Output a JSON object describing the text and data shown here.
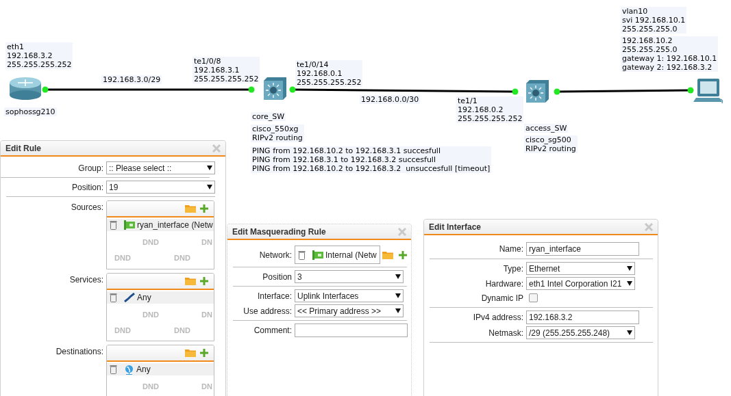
{
  "diagram": {
    "devices": [
      {
        "kind": "router"
      },
      {
        "kind": "switch"
      },
      {
        "kind": "switch"
      },
      {
        "kind": "pc"
      }
    ],
    "labels": [
      {
        "lines": [
          "eth1",
          "192.168.3.2",
          "255.255.255.252"
        ]
      },
      {
        "lines": [
          "192.168.3.0/29"
        ]
      },
      {
        "lines": [
          "te1/0/8",
          "192.168.3.1",
          "255.255.255.252"
        ]
      },
      {
        "lines": [
          "te1/0/14",
          "192.168.0.1",
          "255.255.255.252"
        ]
      },
      {
        "lines": [
          "sophossg210"
        ]
      },
      {
        "lines": [
          "core_SW"
        ]
      },
      {
        "lines": [
          "cisco_550xg",
          "RIPv2 routing"
        ]
      },
      {
        "lines": [
          "PING from 192.168.10.2 to 192.168.3.1 succesfull",
          "PING from 192.168.3.1 to 192.168.3.2 succesfull",
          "PING from 192.168.10.2 to 192.168.3.2  unsuccesfull [timeout]"
        ]
      },
      {
        "lines": [
          "192.168.0.0/30"
        ]
      },
      {
        "lines": [
          "te1/1",
          "192.168.0.2",
          "255.255.255.252"
        ]
      },
      {
        "lines": [
          "access_SW"
        ]
      },
      {
        "lines": [
          "cisco_sg500",
          "RIPv2 routing"
        ]
      },
      {
        "lines": [
          "vlan10",
          "svi 192.168.10.1",
          "255.255.255.0"
        ]
      },
      {
        "lines": [
          "192.168.10.2",
          "255.255.255.0",
          "gateway 1: 192.168.10.1",
          "gateway 2: 192.168.3.2"
        ]
      }
    ]
  },
  "edit_rule": {
    "title": "Edit Rule",
    "sections": [
      [
        {
          "kind": "select",
          "label": "Group:",
          "value": ":: Please select ::"
        }
      ],
      [
        {
          "kind": "select",
          "label": "Position:",
          "value": "19"
        }
      ]
    ],
    "lists": [
      {
        "label": "Sources:",
        "item": {
          "kind": "network",
          "text": "ryan_interface (Netw"
        },
        "watermark": [
          [
            "DND",
            "DN"
          ],
          [
            "DND",
            "DND"
          ]
        ]
      },
      {
        "label": "Services:",
        "item": {
          "kind": "service",
          "text": "Any"
        },
        "watermark": [
          [
            "DND",
            "DN"
          ],
          [
            "DND",
            "DND"
          ]
        ]
      },
      {
        "label": "Destinations:",
        "item": {
          "kind": "globe",
          "text": "Any"
        },
        "watermark": [
          [
            "DND",
            "DN"
          ]
        ]
      }
    ]
  },
  "masquerading": {
    "title": "Edit Masquerading Rule",
    "sections": [
      [
        {
          "kind": "object",
          "label": "Network:",
          "item": {
            "kind": "network",
            "text": "Internal (Netw"
          }
        }
      ],
      [
        {
          "kind": "select",
          "label": "Position",
          "value": "3"
        }
      ],
      [
        {
          "kind": "select",
          "label": "Interface:",
          "value": "Uplink Interfaces"
        },
        {
          "kind": "select",
          "label": "Use address:",
          "value": "<< Primary address >>"
        }
      ],
      [
        {
          "kind": "text",
          "label": "Comment:"
        }
      ]
    ]
  },
  "edit_interface": {
    "title": "Edit Interface",
    "sections": [
      [
        {
          "kind": "text",
          "label": "Name:",
          "value": "ryan_interface"
        }
      ],
      [
        {
          "kind": "select",
          "label": "Type:",
          "value": "Ethernet"
        },
        {
          "kind": "select",
          "label": "Hardware:",
          "value": "eth1 Intel Corporation I21"
        },
        {
          "kind": "checkbox",
          "label": "Dynamic IP",
          "checked": false
        }
      ],
      [
        {
          "kind": "text",
          "label": "IPv4 address:",
          "value": "192.168.3.2"
        },
        {
          "kind": "select",
          "label": "Netmask:",
          "value": "/29 (255.255.255.248)"
        }
      ]
    ]
  }
}
